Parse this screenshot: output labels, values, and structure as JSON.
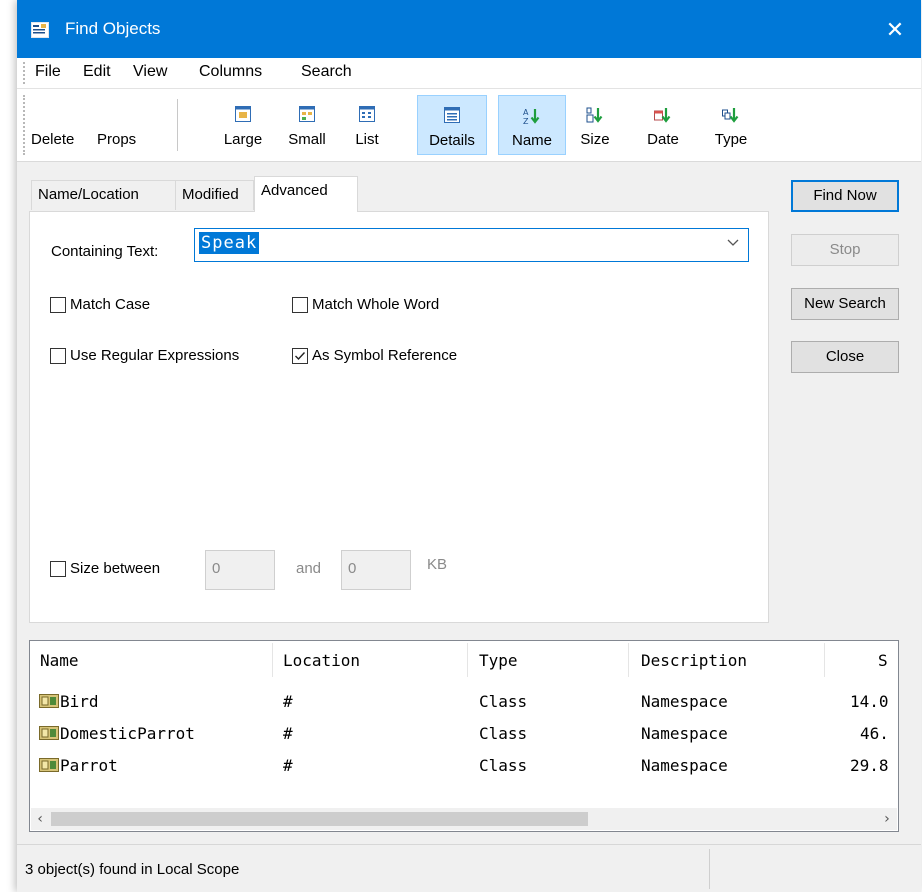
{
  "window": {
    "title": "Find Objects",
    "close_glyph": "✕"
  },
  "menu": [
    "File",
    "Edit",
    "View",
    "Columns",
    "Search"
  ],
  "toolbar": {
    "delete": "Delete",
    "props": "Props",
    "view_buttons": [
      {
        "label": "Large",
        "icon": "large-icons-icon",
        "active": false
      },
      {
        "label": "Small",
        "icon": "small-icons-icon",
        "active": false
      },
      {
        "label": "List",
        "icon": "list-icon",
        "active": false
      },
      {
        "label": "Details",
        "icon": "details-icon",
        "active": true
      }
    ],
    "sort_buttons": [
      {
        "label": "Name",
        "icon": "sort-name-icon",
        "active": true
      },
      {
        "label": "Size",
        "icon": "sort-size-icon",
        "active": false
      },
      {
        "label": "Date",
        "icon": "sort-date-icon",
        "active": false
      },
      {
        "label": "Type",
        "icon": "sort-type-icon",
        "active": false
      }
    ]
  },
  "tabs": [
    {
      "label": "Name/Location",
      "selected": false
    },
    {
      "label": "Modified",
      "selected": false
    },
    {
      "label": "Advanced",
      "selected": true
    }
  ],
  "advanced": {
    "containing_text_label": "Containing Text:",
    "containing_text_value": "Speak",
    "match_case": {
      "label": "Match Case",
      "checked": false
    },
    "match_whole_word": {
      "label": "Match Whole Word",
      "checked": false
    },
    "use_regex": {
      "label": "Use Regular Expressions",
      "checked": false
    },
    "as_symbol_reference": {
      "label": "As Symbol Reference",
      "checked": true
    },
    "size_between": {
      "label": "Size between",
      "checked": false,
      "min": "0",
      "and_label": "and",
      "max": "0",
      "unit": "KB"
    }
  },
  "buttons": {
    "find_now": "Find Now",
    "stop": "Stop",
    "new_search": "New Search",
    "close": "Close"
  },
  "results": {
    "columns": [
      "Name",
      "Location",
      "Type",
      "Description",
      "S"
    ],
    "rows": [
      {
        "name": "Bird",
        "location": "#",
        "type": "Class",
        "description": "Namespace",
        "size": "14.0"
      },
      {
        "name": "DomesticParrot",
        "location": "#",
        "type": "Class",
        "description": "Namespace",
        "size": "46."
      },
      {
        "name": "Parrot",
        "location": "#",
        "type": "Class",
        "description": "Namespace",
        "size": "29.8"
      }
    ]
  },
  "status": {
    "text": "3 object(s) found in Local Scope"
  },
  "colors": {
    "title_bar": "#0078d7",
    "selection": "#cce8ff",
    "accent": "#0078d7"
  }
}
